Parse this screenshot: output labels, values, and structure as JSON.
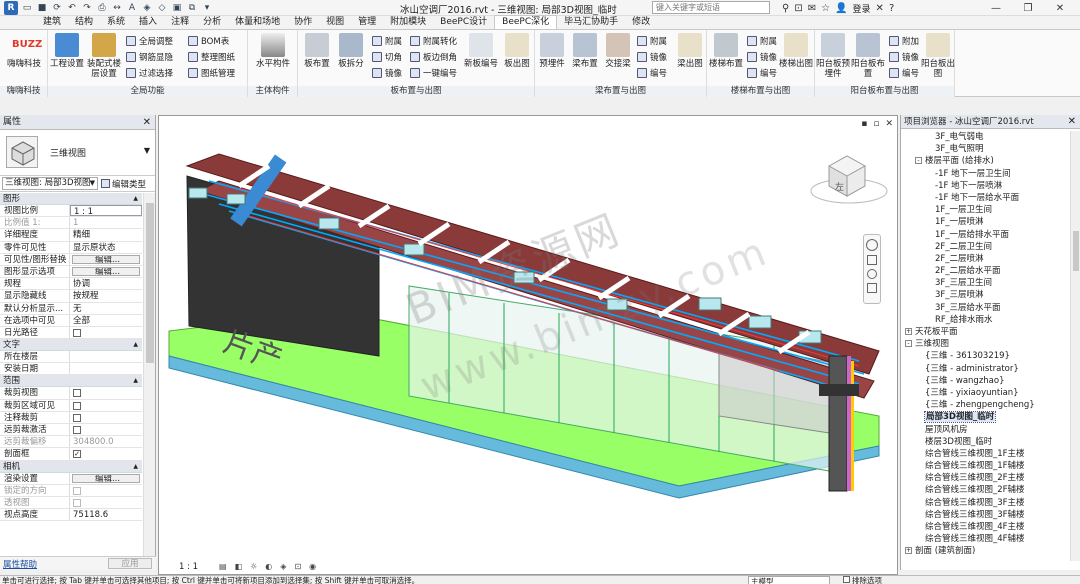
{
  "window": {
    "title": "冰山空调厂2016.rvt - 三维视图: 局部3D视图_临时",
    "search_placeholder": "键入关键字或短语",
    "login": "登录",
    "app_logo": "R"
  },
  "ribbon_tabs": [
    "建筑",
    "结构",
    "系统",
    "插入",
    "注释",
    "分析",
    "体量和场地",
    "协作",
    "视图",
    "管理",
    "附加模块",
    "BeePC设计",
    "BeePC深化",
    "毕马汇协助手",
    "修改"
  ],
  "ribbon_active_tab": "BeePC深化",
  "ribbon_groups": {
    "g1": {
      "label": "嗨嗨科技",
      "big": [
        "嗨嗨科技"
      ]
    },
    "g2": {
      "label": "全局功能",
      "big": [
        "工程设置",
        "装配式楼层设置"
      ],
      "small": [
        "全局调整",
        "钢筋显隐",
        "过滤选择",
        "BOM表",
        "整理图纸",
        "图纸管理"
      ]
    },
    "g3": {
      "label": "主体构件",
      "big": [
        "水平构件"
      ]
    },
    "g4": {
      "label": "板布置与出图",
      "big": [
        "板布置",
        "板拆分",
        "新板编号",
        "板出图"
      ],
      "small": [
        "附属",
        "切角",
        "镜像",
        "附属转化",
        "板边倒角",
        "一键编号"
      ]
    },
    "g5": {
      "label": "梁布置与出图",
      "big": [
        "预埋件",
        "梁布置",
        "交接梁",
        "梁出图"
      ],
      "small": [
        "附属",
        "镜像",
        "编号"
      ]
    },
    "g6": {
      "label": "楼梯布置与出图",
      "big": [
        "楼梯布置",
        "楼梯出图"
      ],
      "small": [
        "附属",
        "镜像",
        "编号"
      ]
    },
    "g7": {
      "label": "阳台板布置与出图",
      "big": [
        "阳台板预埋件",
        "阳台板布置",
        "阳台板出图"
      ],
      "small": [
        "附加",
        "镜像",
        "编号"
      ]
    }
  },
  "properties": {
    "title": "属性",
    "type_name": "三维视图",
    "view_selector": "三维视图: 局部3D视图",
    "edit_type": "编辑类型",
    "help": "属性帮助",
    "apply": "应用",
    "sections": [
      {
        "name": "图形",
        "rows": [
          {
            "k": "视图比例",
            "v": "1 : 1",
            "style": "box"
          },
          {
            "k": "比例值 1:",
            "v": "1",
            "style": "grey"
          },
          {
            "k": "详细程度",
            "v": "精细"
          },
          {
            "k": "零件可见性",
            "v": "显示原状态"
          },
          {
            "k": "可见性/图形替换",
            "v": "编辑...",
            "style": "btn"
          },
          {
            "k": "图形显示选项",
            "v": "编辑...",
            "style": "btn"
          },
          {
            "k": "规程",
            "v": "协调"
          },
          {
            "k": "显示隐藏线",
            "v": "按规程"
          },
          {
            "k": "默认分析显示...",
            "v": "无"
          },
          {
            "k": "在选项中可见",
            "v": "全部"
          },
          {
            "k": "日光路径",
            "v": "",
            "style": "cb"
          }
        ]
      },
      {
        "name": "文字",
        "rows": [
          {
            "k": "所在楼层",
            "v": ""
          },
          {
            "k": "安装日期",
            "v": ""
          }
        ]
      },
      {
        "name": "范围",
        "rows": [
          {
            "k": "裁剪视图",
            "v": "",
            "style": "cb"
          },
          {
            "k": "裁剪区域可见",
            "v": "",
            "style": "cb"
          },
          {
            "k": "注释裁剪",
            "v": "",
            "style": "cb"
          },
          {
            "k": "远剪裁激活",
            "v": "",
            "style": "cb"
          },
          {
            "k": "远剪裁偏移",
            "v": "304800.0",
            "style": "grey"
          },
          {
            "k": "剖面框",
            "v": "✓",
            "style": "cbon"
          }
        ]
      },
      {
        "name": "相机",
        "rows": [
          {
            "k": "渲染设置",
            "v": "编辑...",
            "style": "btn"
          },
          {
            "k": "锁定的方向",
            "v": "",
            "style": "cbgrey"
          },
          {
            "k": "透视图",
            "v": "",
            "style": "cbgrey"
          },
          {
            "k": "视点高度",
            "v": "75118.6"
          }
        ]
      }
    ]
  },
  "viewport": {
    "scale": "1 : 1",
    "watermark_1": "BIM资源网",
    "watermark_2": "www.bimzy.com",
    "viewcube_face": "左",
    "sign_text": "片产"
  },
  "browser": {
    "title": "项目浏览器 - 冰山空调厂2016.rvt",
    "nodes": [
      {
        "t": "3F_电气弱电",
        "lvl": 3
      },
      {
        "t": "3F_电气照明",
        "lvl": 3
      },
      {
        "t": "楼层平面 (给排水)",
        "lvl": 2,
        "exp": "-"
      },
      {
        "t": "-1F 地下一层卫生间",
        "lvl": 3
      },
      {
        "t": "-1F 地下一层喷淋",
        "lvl": 3
      },
      {
        "t": "-1F 地下一层给水平面",
        "lvl": 3
      },
      {
        "t": "1F_一层卫生间",
        "lvl": 3
      },
      {
        "t": "1F_一层喷淋",
        "lvl": 3
      },
      {
        "t": "1F_一层给排水平面",
        "lvl": 3
      },
      {
        "t": "2F_二层卫生间",
        "lvl": 3
      },
      {
        "t": "2F_二层喷淋",
        "lvl": 3
      },
      {
        "t": "2F_二层给水平面",
        "lvl": 3
      },
      {
        "t": "3F_三层卫生间",
        "lvl": 3
      },
      {
        "t": "3F_三层喷淋",
        "lvl": 3
      },
      {
        "t": "3F_三层给水平面",
        "lvl": 3
      },
      {
        "t": "RF_给排水雨水",
        "lvl": 3
      },
      {
        "t": "天花板平面",
        "lvl": 1,
        "exp": "+"
      },
      {
        "t": "三维视图",
        "lvl": 1,
        "exp": "-"
      },
      {
        "t": "{三维 - 361303219}",
        "lvl": 2
      },
      {
        "t": "{三维 - administrator}",
        "lvl": 2
      },
      {
        "t": "{三维 - wangzhao}",
        "lvl": 2
      },
      {
        "t": "{三维 - yixiaoyuntian}",
        "lvl": 2
      },
      {
        "t": "{三维 - zhengpengcheng}",
        "lvl": 2
      },
      {
        "t": "局部3D视图_临时",
        "lvl": 2,
        "sel": true
      },
      {
        "t": "屋顶风机房",
        "lvl": 2
      },
      {
        "t": "楼层3D视图_临时",
        "lvl": 2
      },
      {
        "t": "综合管线三维视图_1F主楼",
        "lvl": 2
      },
      {
        "t": "综合管线三维视图_1F辅楼",
        "lvl": 2
      },
      {
        "t": "综合管线三维视图_2F主楼",
        "lvl": 2
      },
      {
        "t": "综合管线三维视图_2F辅楼",
        "lvl": 2
      },
      {
        "t": "综合管线三维视图_3F主楼",
        "lvl": 2
      },
      {
        "t": "综合管线三维视图_3F辅楼",
        "lvl": 2
      },
      {
        "t": "综合管线三维视图_4F主楼",
        "lvl": 2
      },
      {
        "t": "综合管线三维视图_4F辅楼",
        "lvl": 2
      },
      {
        "t": "剖面 (建筑剖面)",
        "lvl": 1,
        "exp": "+"
      }
    ]
  },
  "statusbar": {
    "text": "单击可进行选择; 按 Tab 键并单击可选择其他项目; 按 Ctrl 键并单击可将新项目添加到选择集; 按 Shift 键并单击可取消选择。",
    "model": "主模型",
    "filter": "排除选项"
  },
  "colors": {
    "beam": "#8b3a3a",
    "floor": "#99ff66",
    "pipe": "#00aaff",
    "accent": "#1a66b3"
  }
}
